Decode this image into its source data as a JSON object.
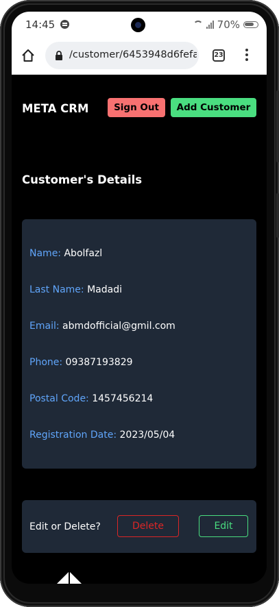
{
  "status_bar": {
    "time": "14:45",
    "battery": "70%",
    "icons": [
      "spotify-icon",
      "wifi-icon",
      "signal-icon",
      "battery-icon"
    ]
  },
  "browser": {
    "url": "/customer/6453948d6fefa",
    "tab_count": "23"
  },
  "app": {
    "title": "META CRM",
    "sign_out_label": "Sign Out",
    "add_customer_label": "Add Customer",
    "section_title": "Customer's Details"
  },
  "customer": {
    "name_label": "Name:",
    "name": "Abolfazl",
    "last_name_label": "Last Name:",
    "last_name": "Madadi",
    "email_label": "Email:",
    "email": "abmdofficial@gmil.com",
    "phone_label": "Phone:",
    "phone": "09387193829",
    "postal_code_label": "Postal Code:",
    "postal_code": "1457456214",
    "registration_date_label": "Registration Date:",
    "registration_date": "2023/05/04"
  },
  "actions": {
    "prompt": "Edit or Delete?",
    "delete_label": "Delete",
    "edit_label": "Edit"
  },
  "colors": {
    "background": "#000000",
    "card": "#1f2937",
    "label": "#60a5fa",
    "sign_out": "#f87171",
    "add_customer": "#4ade80",
    "delete": "#dc2626",
    "edit": "#4ade80"
  }
}
